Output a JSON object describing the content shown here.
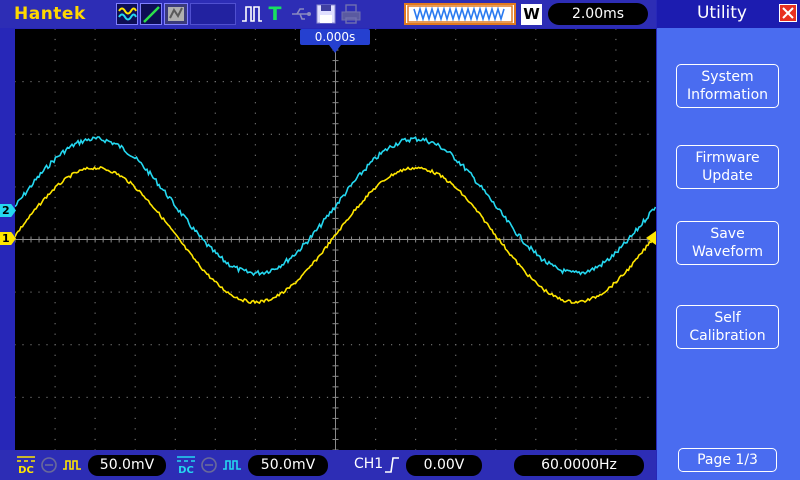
{
  "top_bar": {
    "brand": "Hantek",
    "timebase": "2.00ms",
    "mode_badge": "W"
  },
  "screen": {
    "trigger_position": "0.000s",
    "ch1_marker": "1",
    "ch2_marker": "2"
  },
  "menu": {
    "title": "Utility",
    "items": [
      {
        "line1": "System",
        "line2": "Information"
      },
      {
        "line1": "Firmware",
        "line2": "Update"
      },
      {
        "line1": "Save",
        "line2": "Waveform"
      },
      {
        "line1": "Self",
        "line2": "Calibration"
      }
    ],
    "page": "Page 1/3"
  },
  "bottom_bar": {
    "ch1_coupling": "DC",
    "ch1_scale": "50.0mV",
    "ch2_coupling": "DC",
    "ch2_scale": "50.0mV",
    "trigger_source": "CH1",
    "trigger_level": "0.00V",
    "frequency": "60.0000Hz"
  },
  "colors": {
    "ch1": "#ffe600",
    "ch2": "#25d8f0",
    "panel": "#4a6cf0",
    "bar": "#2d2db5"
  }
}
